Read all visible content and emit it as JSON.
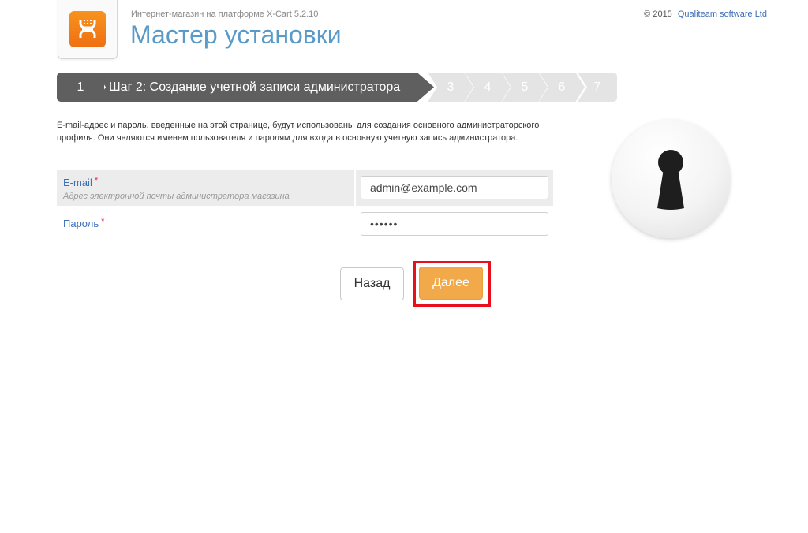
{
  "header": {
    "platform_text": "Интернет-магазин на платформе X-Cart 5.2.10",
    "title": "Мастер установки",
    "copyright_prefix": "© 2015",
    "copyright_link": "Qualiteam software Ltd",
    "logo_icon": "xcart-logo-icon",
    "brand_color": "#f2951f"
  },
  "steps": {
    "first": "1",
    "current": "Шаг 2: Создание учетной записи администратора",
    "remaining": [
      "3",
      "4",
      "5",
      "6",
      "7"
    ]
  },
  "intro": "E-mail-адрес и пароль, введенные на этой странице, будут использованы для создания основного администраторского профиля. Они являются именем пользователя и паролям для входа в основную учетную запись администратора.",
  "form": {
    "email": {
      "label": "E-mail",
      "required_mark": "*",
      "hint": "Адрес электронной почты администратора магазина",
      "value": "admin@example.com"
    },
    "password": {
      "label": "Пароль",
      "required_mark": "*",
      "value": "••••••"
    }
  },
  "buttons": {
    "back": "Назад",
    "next": "Далее",
    "next_color": "#f2a94a"
  },
  "illustration": {
    "icon": "keyhole-icon"
  }
}
